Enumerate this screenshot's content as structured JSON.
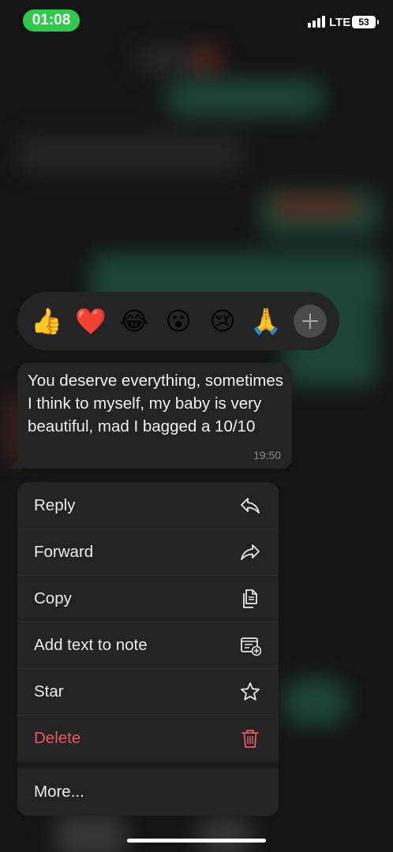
{
  "status_bar": {
    "time": "01:08",
    "network": "LTE",
    "battery": "53"
  },
  "reactions": {
    "items": [
      {
        "emoji": "👍",
        "icon": "thumbs-up-icon"
      },
      {
        "emoji": "❤️",
        "icon": "red-heart-icon"
      },
      {
        "emoji": "😂",
        "icon": "tears-of-joy-icon"
      },
      {
        "emoji": "😮",
        "icon": "surprised-face-icon"
      },
      {
        "emoji": "😢",
        "icon": "crying-face-icon"
      },
      {
        "emoji": "🙏",
        "icon": "folded-hands-icon"
      }
    ],
    "more_icon": "plus-icon"
  },
  "message": {
    "text": "You deserve everything, sometimes I think to myself, my baby is very beautiful, mad I bagged a 10/10",
    "time": "19:50"
  },
  "menu": {
    "items": [
      {
        "label": "Reply",
        "icon": "reply-icon"
      },
      {
        "label": "Forward",
        "icon": "forward-icon"
      },
      {
        "label": "Copy",
        "icon": "copy-icon"
      },
      {
        "label": "Add text to note",
        "icon": "add-note-icon"
      },
      {
        "label": "Star",
        "icon": "star-icon"
      },
      {
        "label": "Delete",
        "icon": "trash-icon"
      }
    ],
    "more_label": "More..."
  },
  "colors": {
    "status_pill": "#2fc94e",
    "surface": "#232323",
    "text": "#ececec",
    "danger": "#e85866",
    "secondary_text": "#8c8c8c"
  }
}
